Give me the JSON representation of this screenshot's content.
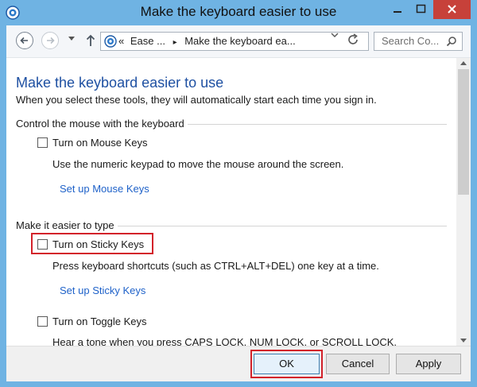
{
  "window": {
    "title": "Make the keyboard easier to use"
  },
  "navbar": {
    "address_prefix": "«",
    "breadcrumb_1": "Ease ...",
    "breadcrumb_sep": "▸",
    "breadcrumb_2": "Make the keyboard ea...",
    "search_placeholder": "Search Co..."
  },
  "page": {
    "heading": "Make the keyboard easier to use",
    "intro": "When you select these tools, they will automatically start each time you sign in."
  },
  "sections": [
    {
      "header": "Control the mouse with the keyboard",
      "option_label": "Turn on Mouse Keys",
      "option_checked": false,
      "description": "Use the numeric keypad to move the mouse around the screen.",
      "link": "Set up Mouse Keys"
    },
    {
      "header": "Make it easier to type",
      "option_label": "Turn on Sticky Keys",
      "option_checked": false,
      "description": "Press keyboard shortcuts (such as CTRL+ALT+DEL) one key at a time.",
      "link": "Set up Sticky Keys"
    },
    {
      "option_label": "Turn on Toggle Keys",
      "option_checked": false,
      "description": "Hear a tone when you press CAPS LOCK, NUM LOCK, or SCROLL LOCK."
    }
  ],
  "footer": {
    "ok": "OK",
    "cancel": "Cancel",
    "apply": "Apply"
  },
  "colors": {
    "titlebar": "#6fb3e3",
    "close_button": "#c7413a",
    "heading": "#1e50a2",
    "link": "#1f62c9",
    "highlight": "#d3222a"
  }
}
